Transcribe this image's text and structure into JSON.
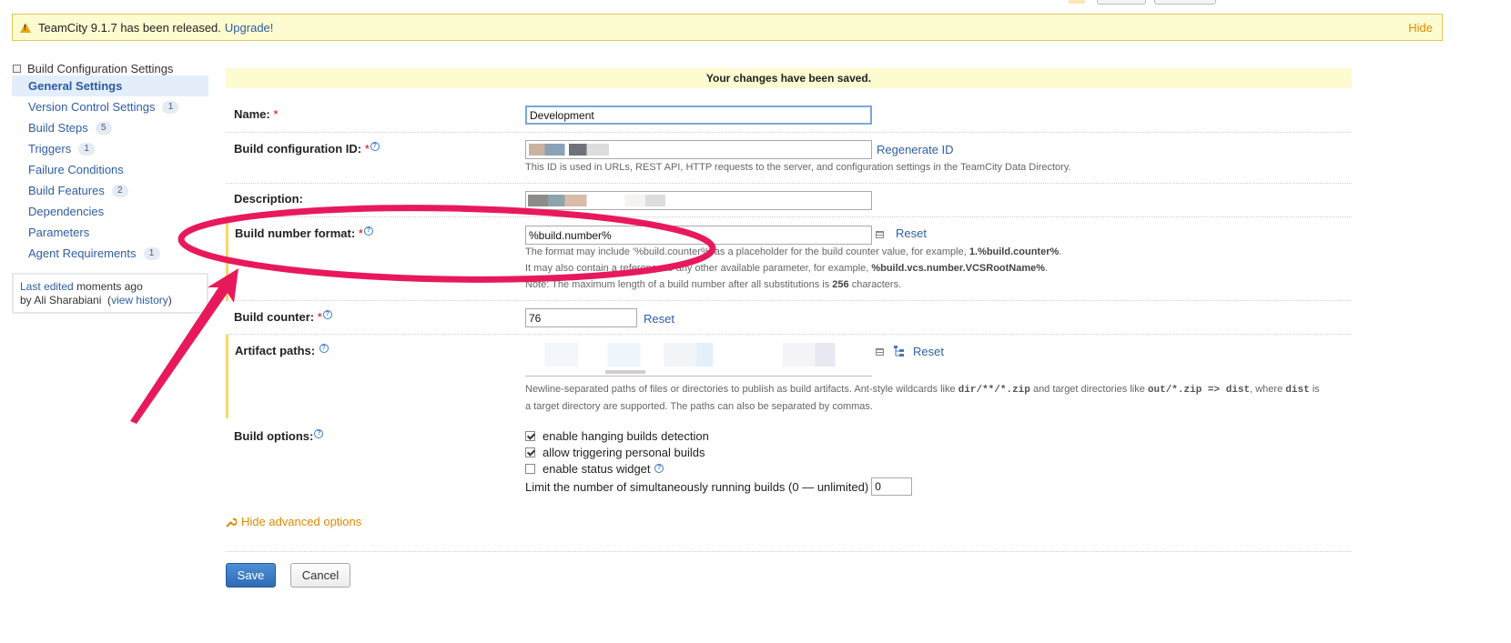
{
  "banner": {
    "message": "TeamCity 9.1.7 has been released.",
    "upgrade_link": "Upgrade!",
    "hide_link": "Hide"
  },
  "sidebar": {
    "title": "Build Configuration Settings",
    "items": [
      {
        "label": "General Settings",
        "count": null
      },
      {
        "label": "Version Control Settings",
        "count": "1"
      },
      {
        "label": "Build Steps",
        "count": "5"
      },
      {
        "label": "Triggers",
        "count": "1"
      },
      {
        "label": "Failure Conditions",
        "count": null
      },
      {
        "label": "Build Features",
        "count": "2"
      },
      {
        "label": "Dependencies",
        "count": null
      },
      {
        "label": "Parameters",
        "count": null
      },
      {
        "label": "Agent Requirements",
        "count": "1"
      }
    ],
    "last_edited": {
      "link": "Last edited",
      "time": "moments ago",
      "by_prefix": "by Ali Sharabiani",
      "history_link": "view history"
    }
  },
  "form": {
    "saved_message": "Your changes have been saved.",
    "name": {
      "label": "Name:",
      "value": "Development"
    },
    "config_id": {
      "label": "Build configuration ID:",
      "regenerate": "Regenerate ID",
      "note": "This ID is used in URLs, REST API, HTTP requests to the server, and configuration settings in the TeamCity Data Directory."
    },
    "description": {
      "label": "Description:"
    },
    "build_number": {
      "label": "Build number format:",
      "value": "%build.number%",
      "reset": "Reset",
      "note1_pre": "The format may include '%build.counter%' as a placeholder for the build counter value, for example, ",
      "note1_bold": "1.%build.counter%",
      "note1_post": ".",
      "note2_pre": "It may also contain a reference to any other available parameter, for example, ",
      "note2_bold": "%build.vcs.number.VCSRootName%",
      "note2_post": ".",
      "note3_pre": "Note: The maximum length of a build number after all substitutions is ",
      "note3_bold": "256",
      "note3_post": " characters."
    },
    "build_counter": {
      "label": "Build counter:",
      "value": "76",
      "reset": "Reset"
    },
    "artifact_paths": {
      "label": "Artifact paths:",
      "reset": "Reset",
      "note_a": "Newline-separated paths of files or directories to publish as build artifacts. Ant-style wildcards like ",
      "code1": "dir/**/*.zip",
      "note_b": " and target directories like ",
      "code2": "out/*.zip => dist",
      "note_c": ", where ",
      "code3": "dist",
      "note_d": " is",
      "note_line2": "a target directory are supported. The paths can also be separated by commas."
    },
    "build_options": {
      "label": "Build options:",
      "opt1": "enable hanging builds detection",
      "opt2": "allow triggering personal builds",
      "opt3": "enable status widget",
      "limit_label": "Limit the number of simultaneously running builds (0 — unlimited)",
      "limit_value": "0"
    },
    "hide_advanced": "Hide advanced options",
    "save": "Save",
    "cancel": "Cancel"
  },
  "colors": {
    "accent_blue": "#2e5ea3",
    "banner_bg": "#fdfbd0",
    "annotation": "#e8195a",
    "orange_link": "#e08a00"
  }
}
